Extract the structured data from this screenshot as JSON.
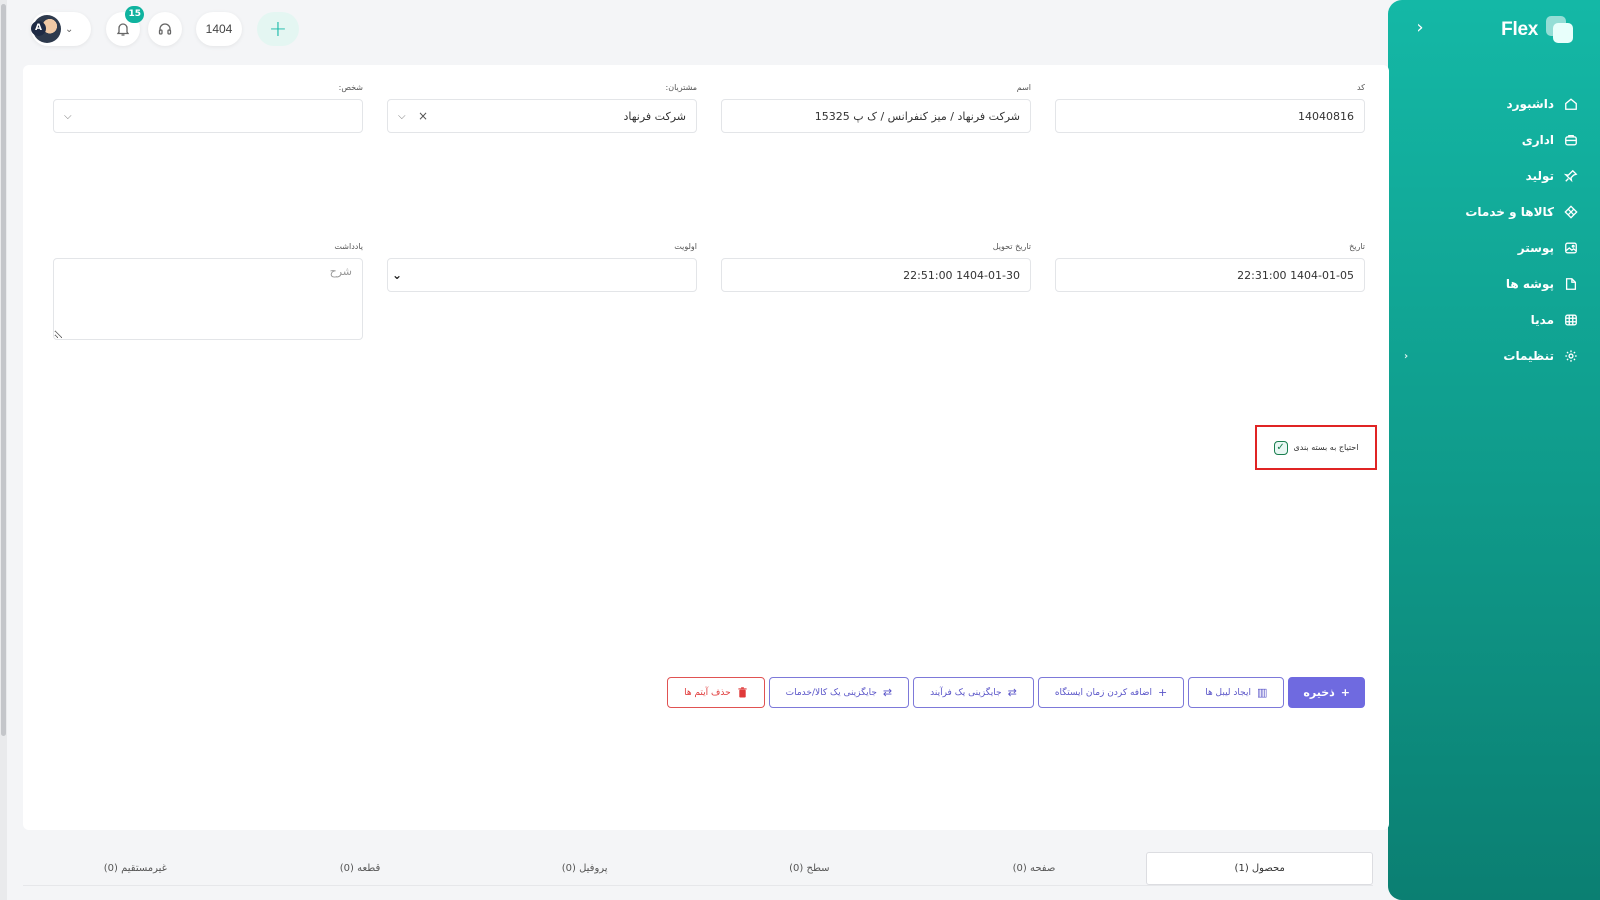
{
  "app": {
    "brand": "Flex"
  },
  "sidebar": {
    "items": [
      {
        "label": "داشبورد",
        "icon": "home-icon"
      },
      {
        "label": "اداری",
        "icon": "briefcase-icon"
      },
      {
        "label": "تولید",
        "icon": "pin-icon"
      },
      {
        "label": "کالاها و خدمات",
        "icon": "grid-icon"
      },
      {
        "label": "پوستر",
        "icon": "image-icon"
      },
      {
        "label": "پوشه ها",
        "icon": "folder-icon"
      },
      {
        "label": "مدیا",
        "icon": "media-icon"
      },
      {
        "label": "تنظیمات",
        "icon": "gear-icon",
        "has_submenu": true
      }
    ]
  },
  "topbar": {
    "avatar_initial": "A",
    "notifications_count": "15",
    "year": "1404",
    "add_symbol": "+"
  },
  "form": {
    "code": {
      "label": "کد",
      "value": "14040816"
    },
    "name": {
      "label": "اسم",
      "value": "شرکت فرنهاد / میز کنفرانس / ک پ 15325"
    },
    "customer": {
      "label": "مشتریان:",
      "value": "شرکت فرنهاد"
    },
    "person": {
      "label": "شخص:",
      "value": ""
    },
    "date": {
      "label": "تاریخ",
      "value": "1404-01-05 22:31:00"
    },
    "delivery_date": {
      "label": "تاریخ تحویل",
      "value": "1404-01-30 22:51:00"
    },
    "priority": {
      "label": "اولویت",
      "value": ""
    },
    "note": {
      "label": "یادداشت",
      "placeholder": "شرح"
    },
    "packaging": {
      "label": "احتیاج به بسته بندی",
      "checked": true
    }
  },
  "actions": {
    "save": "ذخیره",
    "create_labels": "ایجاد لیبل ها",
    "add_station_time": "اضافه کردن زمان ایستگاه",
    "replace_process": "جایگزینی یک فرآیند",
    "replace_product": "جایگزینی یک کالا/خدمات",
    "delete_items": "حذف آیتم ها"
  },
  "tabs": [
    {
      "label": "محصول (1)",
      "active": true
    },
    {
      "label": "صفحه (0)"
    },
    {
      "label": "سطح (0)"
    },
    {
      "label": "پروفیل (0)"
    },
    {
      "label": "قطعه (0)"
    },
    {
      "label": "غیرمستقیم (0)"
    }
  ],
  "colors": {
    "sidebar_top": "#14b8a6",
    "sidebar_bottom": "#0b7f72",
    "primary_button": "#6f6ae0",
    "danger": "#e03a3a",
    "highlight_border": "#e02424"
  }
}
